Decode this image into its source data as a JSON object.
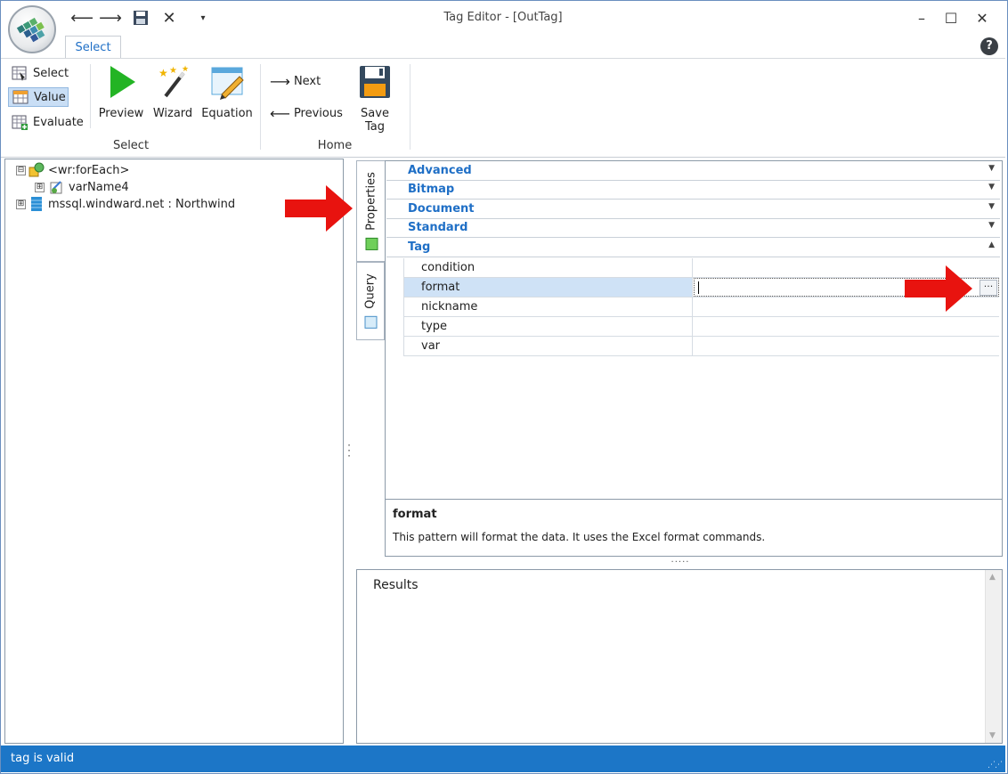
{
  "window": {
    "title": "Tag Editor - [OutTag]",
    "logo_icon": "windward-logo-icon",
    "qat_icons": [
      "back-arrow-icon",
      "forward-arrow-icon",
      "save-disk-icon",
      "close-x-icon",
      "dropdown-caret-icon"
    ],
    "controls": {
      "minimize": "–",
      "maximize": "☐",
      "close": "✕"
    },
    "help_icon": "?"
  },
  "ribbon": {
    "tab": "Select",
    "select_group": {
      "label": "Select",
      "small_buttons": [
        {
          "label": "Select",
          "selected": false
        },
        {
          "label": "Value",
          "selected": true
        },
        {
          "label": "Evaluate",
          "selected": false
        }
      ],
      "large_buttons": [
        {
          "label": "Preview",
          "icon": "play-icon"
        },
        {
          "label": "Wizard",
          "icon": "magic-wand-icon"
        },
        {
          "label": "Equation",
          "icon": "equation-pencil-icon"
        }
      ]
    },
    "home_group": {
      "label": "Home",
      "next": "Next",
      "previous": "Previous",
      "save_tag": "Save Tag"
    }
  },
  "tree": [
    {
      "label": "<wr:forEach>",
      "level": 0,
      "expander": "⊟"
    },
    {
      "label": "varName4",
      "level": 1,
      "expander": "⊞"
    },
    {
      "label": "mssql.windward.net : Northwind",
      "level": 0,
      "expander": "⊞"
    }
  ],
  "side_tabs": {
    "properties": "Properties",
    "query": "Query"
  },
  "property_grid": {
    "categories": [
      "Advanced",
      "Bitmap",
      "Document",
      "Standard",
      "Tag"
    ],
    "tag_properties": [
      {
        "name": "condition",
        "value": ""
      },
      {
        "name": "format",
        "value": "",
        "selected": true
      },
      {
        "name": "nickname",
        "value": ""
      },
      {
        "name": "type",
        "value": ""
      },
      {
        "name": "var",
        "value": ""
      }
    ],
    "ellipsis": "···"
  },
  "description": {
    "title": "format",
    "text": "This pattern will format the data. It uses the Excel format commands."
  },
  "results": {
    "label": "Results"
  },
  "status": {
    "text": "tag is valid"
  },
  "colors": {
    "accent": "#1c76c7",
    "link": "#1f6fc6",
    "arrow": "#e8130f",
    "selection": "#cfe2f6"
  }
}
